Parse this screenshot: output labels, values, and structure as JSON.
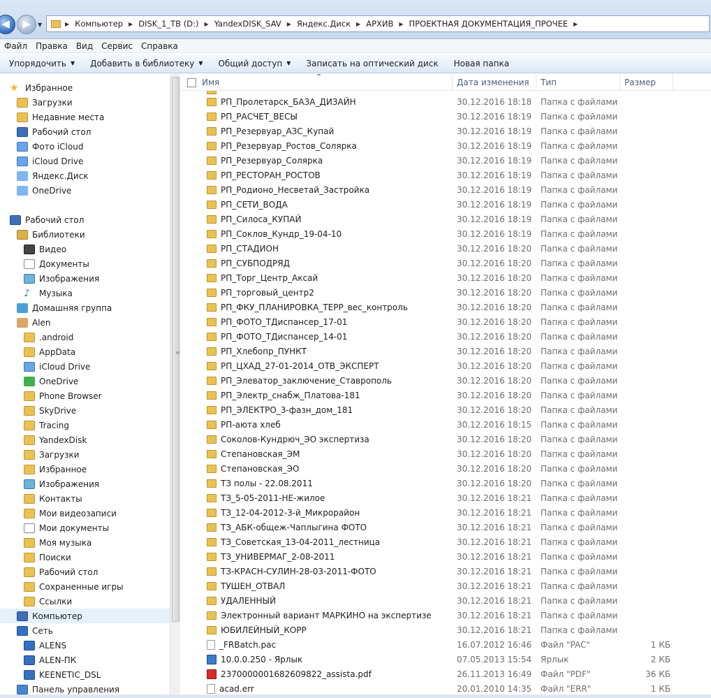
{
  "address": {
    "crumbs": [
      "Компьютер",
      "DISK_1_TB (D:)",
      "YandexDISK_SAV",
      "Яндекс.Диск",
      "АРХИВ",
      "ПРОЕКТНАЯ ДОКУМЕНТАЦИЯ_ПРОЧЕЕ"
    ]
  },
  "menu": [
    "Файл",
    "Правка",
    "Вид",
    "Сервис",
    "Справка"
  ],
  "toolbar": {
    "organize": "Упорядочить",
    "add_library": "Добавить в библиотеку",
    "share": "Общий доступ",
    "burn": "Записать на оптический диск",
    "new_folder": "Новая папка"
  },
  "nav": [
    {
      "label": "Избранное",
      "icon": "star",
      "indent": 14,
      "type": "section"
    },
    {
      "label": "Загрузки",
      "icon": "folder",
      "indent": 24
    },
    {
      "label": "Недавние места",
      "icon": "folder",
      "indent": 24
    },
    {
      "label": "Рабочий стол",
      "icon": "monitor",
      "indent": 24
    },
    {
      "label": "Фото iCloud",
      "icon": "blue",
      "indent": 24
    },
    {
      "label": "iCloud Drive",
      "icon": "blue",
      "indent": 24
    },
    {
      "label": "Яндекс.Диск",
      "icon": "cloud",
      "indent": 24
    },
    {
      "label": "OneDrive",
      "icon": "cloud",
      "indent": 24
    },
    {
      "label": "",
      "icon": "",
      "indent": 0,
      "type": "gap"
    },
    {
      "label": "Рабочий стол",
      "icon": "monitor",
      "indent": 14,
      "type": "section"
    },
    {
      "label": "Библиотеки",
      "icon": "lib",
      "indent": 24
    },
    {
      "label": "Видео",
      "icon": "video",
      "indent": 34
    },
    {
      "label": "Документы",
      "icon": "doc",
      "indent": 34
    },
    {
      "label": "Изображения",
      "icon": "img",
      "indent": 34
    },
    {
      "label": "Музыка",
      "icon": "music",
      "indent": 34
    },
    {
      "label": "Домашняя группа",
      "icon": "group",
      "indent": 24
    },
    {
      "label": "Alen",
      "icon": "user",
      "indent": 24
    },
    {
      "label": ".android",
      "icon": "folder",
      "indent": 34
    },
    {
      "label": "AppData",
      "icon": "folder",
      "indent": 34
    },
    {
      "label": "iCloud Drive",
      "icon": "blue",
      "indent": 34
    },
    {
      "label": "OneDrive",
      "icon": "green",
      "indent": 34
    },
    {
      "label": "Phone Browser",
      "icon": "folder",
      "indent": 34
    },
    {
      "label": "SkyDrive",
      "icon": "folder",
      "indent": 34
    },
    {
      "label": "Tracing",
      "icon": "folder",
      "indent": 34
    },
    {
      "label": "YandexDisk",
      "icon": "folder",
      "indent": 34
    },
    {
      "label": "Загрузки",
      "icon": "folder",
      "indent": 34
    },
    {
      "label": "Избранное",
      "icon": "folder",
      "indent": 34
    },
    {
      "label": "Изображения",
      "icon": "img",
      "indent": 34
    },
    {
      "label": "Контакты",
      "icon": "folder",
      "indent": 34
    },
    {
      "label": "Мои видеозаписи",
      "icon": "folder",
      "indent": 34
    },
    {
      "label": "Мои документы",
      "icon": "doc",
      "indent": 34
    },
    {
      "label": "Моя музыка",
      "icon": "folder",
      "indent": 34
    },
    {
      "label": "Поиски",
      "icon": "folder",
      "indent": 34
    },
    {
      "label": "Рабочий стол",
      "icon": "folder",
      "indent": 34
    },
    {
      "label": "Сохраненные игры",
      "icon": "folder",
      "indent": 34
    },
    {
      "label": "Ссылки",
      "icon": "folder",
      "indent": 34
    },
    {
      "label": "Компьютер",
      "icon": "monitor",
      "indent": 24,
      "selected": true
    },
    {
      "label": "Сеть",
      "icon": "net",
      "indent": 24
    },
    {
      "label": "ALENS",
      "icon": "net",
      "indent": 34
    },
    {
      "label": "ALEN-ПК",
      "icon": "net",
      "indent": 34
    },
    {
      "label": "KEENETIC_DSL",
      "icon": "net",
      "indent": 34
    },
    {
      "label": "Панель управления",
      "icon": "panel",
      "indent": 24
    }
  ],
  "columns": {
    "name": "Имя",
    "date": "Дата изменения",
    "type": "Тип",
    "size": "Размер"
  },
  "files": [
    {
      "name": "РП_Пролетарск_БАЗА_ДИЗАЙН",
      "date": "30.12.2016 18:18",
      "type": "Папка с файлами",
      "size": "",
      "icon": "folder"
    },
    {
      "name": "РП_РАСЧЕТ_ВЕСЫ",
      "date": "30.12.2016 18:19",
      "type": "Папка с файлами",
      "size": "",
      "icon": "folder"
    },
    {
      "name": "РП_Резервуар_АЗС_Купай",
      "date": "30.12.2016 18:19",
      "type": "Папка с файлами",
      "size": "",
      "icon": "folder"
    },
    {
      "name": "РП_Резервуар_Ростов_Солярка",
      "date": "30.12.2016 18:19",
      "type": "Папка с файлами",
      "size": "",
      "icon": "folder"
    },
    {
      "name": "РП_Резервуар_Солярка",
      "date": "30.12.2016 18:19",
      "type": "Папка с файлами",
      "size": "",
      "icon": "folder"
    },
    {
      "name": "РП_РЕСТОРАН_РОСТОВ",
      "date": "30.12.2016 18:19",
      "type": "Папка с файлами",
      "size": "",
      "icon": "folder"
    },
    {
      "name": "РП_Родионо_Несветай_Застройка",
      "date": "30.12.2016 18:19",
      "type": "Папка с файлами",
      "size": "",
      "icon": "folder"
    },
    {
      "name": "РП_СЕТИ_ВОДА",
      "date": "30.12.2016 18:19",
      "type": "Папка с файлами",
      "size": "",
      "icon": "folder"
    },
    {
      "name": "РП_Силоса_КУПАЙ",
      "date": "30.12.2016 18:19",
      "type": "Папка с файлами",
      "size": "",
      "icon": "folder"
    },
    {
      "name": "РП_Соклов_Кундр_19-04-10",
      "date": "30.12.2016 18:19",
      "type": "Папка с файлами",
      "size": "",
      "icon": "folder"
    },
    {
      "name": "РП_СТАДИОН",
      "date": "30.12.2016 18:20",
      "type": "Папка с файлами",
      "size": "",
      "icon": "folder"
    },
    {
      "name": "РП_СУБПОДРЯД",
      "date": "30.12.2016 18:20",
      "type": "Папка с файлами",
      "size": "",
      "icon": "folder"
    },
    {
      "name": "РП_Торг_Центр_Аксай",
      "date": "30.12.2016 18:20",
      "type": "Папка с файлами",
      "size": "",
      "icon": "folder"
    },
    {
      "name": "РП_торговый_центр2",
      "date": "30.12.2016 18:20",
      "type": "Папка с файлами",
      "size": "",
      "icon": "folder"
    },
    {
      "name": "РП_ФКУ_ПЛАНИРОВКА_ТЕРР_вес_контроль",
      "date": "30.12.2016 18:20",
      "type": "Папка с файлами",
      "size": "",
      "icon": "folder"
    },
    {
      "name": "РП_ФОТО_ТДиспансер_17-01",
      "date": "30.12.2016 18:20",
      "type": "Папка с файлами",
      "size": "",
      "icon": "folder"
    },
    {
      "name": "РП_ФОТО_ТДиспансер_14-01",
      "date": "30.12.2016 18:20",
      "type": "Папка с файлами",
      "size": "",
      "icon": "folder"
    },
    {
      "name": "РП_Хлебопр_ПУНКТ",
      "date": "30.12.2016 18:20",
      "type": "Папка с файлами",
      "size": "",
      "icon": "folder"
    },
    {
      "name": "РП_ЦХАД_27-01-2014_ОТВ_ЭКСПЕРТ",
      "date": "30.12.2016 18:20",
      "type": "Папка с файлами",
      "size": "",
      "icon": "folder"
    },
    {
      "name": "РП_Элеватор_заключение_Ставрополь",
      "date": "30.12.2016 18:20",
      "type": "Папка с файлами",
      "size": "",
      "icon": "folder"
    },
    {
      "name": "РП_Электр_снабж_Платова-181",
      "date": "30.12.2016 18:20",
      "type": "Папка с файлами",
      "size": "",
      "icon": "folder"
    },
    {
      "name": "РП_ЭЛЕКТРО_3-фазн_дом_181",
      "date": "30.12.2016 18:20",
      "type": "Папка с файлами",
      "size": "",
      "icon": "folder"
    },
    {
      "name": "РП-аюта хлеб",
      "date": "30.12.2016 18:15",
      "type": "Папка с файлами",
      "size": "",
      "icon": "folder"
    },
    {
      "name": "Соколов-Кундрюч_ЭО экспертиза",
      "date": "30.12.2016 18:20",
      "type": "Папка с файлами",
      "size": "",
      "icon": "folder"
    },
    {
      "name": "Степановская_ЭМ",
      "date": "30.12.2016 18:20",
      "type": "Папка с файлами",
      "size": "",
      "icon": "folder"
    },
    {
      "name": "Степановская_ЭО",
      "date": "30.12.2016 18:20",
      "type": "Папка с файлами",
      "size": "",
      "icon": "folder"
    },
    {
      "name": "ТЗ полы - 22.08.2011",
      "date": "30.12.2016 18:20",
      "type": "Папка с файлами",
      "size": "",
      "icon": "folder"
    },
    {
      "name": "ТЗ_5-05-2011-НЕ-жилое",
      "date": "30.12.2016 18:21",
      "type": "Папка с файлами",
      "size": "",
      "icon": "folder"
    },
    {
      "name": "ТЗ_12-04-2012-3-й_Микрорайон",
      "date": "30.12.2016 18:21",
      "type": "Папка с файлами",
      "size": "",
      "icon": "folder"
    },
    {
      "name": "ТЗ_АБК-общеж-Чаплыгина ФОТО",
      "date": "30.12.2016 18:21",
      "type": "Папка с файлами",
      "size": "",
      "icon": "folder"
    },
    {
      "name": "ТЗ_Советская_13-04-2011_лестница",
      "date": "30.12.2016 18:21",
      "type": "Папка с файлами",
      "size": "",
      "icon": "folder"
    },
    {
      "name": "ТЗ_УНИВЕРМАГ_2-08-2011",
      "date": "30.12.2016 18:21",
      "type": "Папка с файлами",
      "size": "",
      "icon": "folder"
    },
    {
      "name": "ТЗ-КРАСН-СУЛИН-28-03-2011-ФОТО",
      "date": "30.12.2016 18:21",
      "type": "Папка с файлами",
      "size": "",
      "icon": "folder"
    },
    {
      "name": "ТУШЕН_ОТВАЛ",
      "date": "30.12.2016 18:21",
      "type": "Папка с файлами",
      "size": "",
      "icon": "folder"
    },
    {
      "name": "УДАЛЕННЫЙ",
      "date": "30.12.2016 18:21",
      "type": "Папка с файлами",
      "size": "",
      "icon": "folder"
    },
    {
      "name": "Электронный вариант  МАРКИНО на экспертизе",
      "date": "30.12.2016 18:21",
      "type": "Папка с файлами",
      "size": "",
      "icon": "folder"
    },
    {
      "name": "ЮБИЛЕЙНЫЙ_КОРР",
      "date": "30.12.2016 18:21",
      "type": "Папка с файлами",
      "size": "",
      "icon": "folder"
    },
    {
      "name": "_FRBatch.pac",
      "date": "16.07.2012 16:46",
      "type": "Файл \"PAC\"",
      "size": "1 КБ",
      "icon": "file"
    },
    {
      "name": "10.0.0.250 - Ярлык",
      "date": "07.05.2013 15:54",
      "type": "Ярлык",
      "size": "2 КБ",
      "icon": "lnk"
    },
    {
      "name": "2370000001682609822_assista.pdf",
      "date": "26.11.2013 16:49",
      "type": "Файл \"PDF\"",
      "size": "36 КБ",
      "icon": "pdf"
    },
    {
      "name": "acad.err",
      "date": "20.01.2010 14:35",
      "type": "Файл \"ERR\"",
      "size": "1 КБ",
      "icon": "file"
    }
  ]
}
